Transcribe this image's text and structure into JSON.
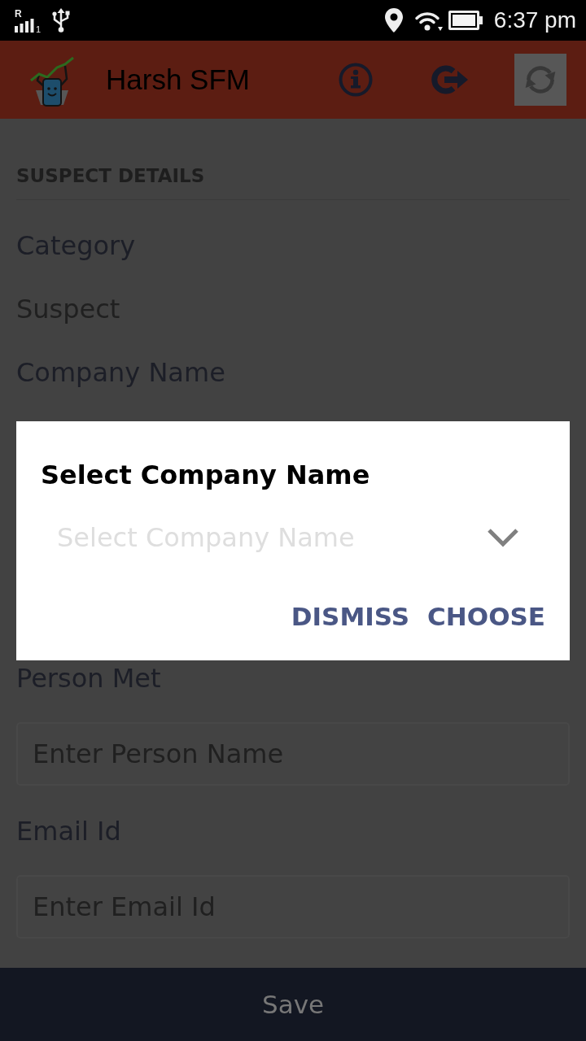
{
  "status_bar": {
    "roaming": "R",
    "sim": "1",
    "time": "6:37 pm"
  },
  "app_bar": {
    "title": "Harsh SFM"
  },
  "form": {
    "section_title": "SUSPECT DETAILS",
    "fields": [
      {
        "kind": "static",
        "label": "Category",
        "value": "Suspect"
      },
      {
        "kind": "picker",
        "label": "Company Name"
      },
      {
        "kind": "input",
        "label": "Person Met",
        "placeholder": "Enter Person Name"
      },
      {
        "kind": "input",
        "label": "Email Id",
        "placeholder": "Enter Email Id"
      }
    ]
  },
  "dialog": {
    "title": "Select Company Name",
    "dropdown": {
      "placeholder": "Select Company Name"
    },
    "buttons": [
      "DISMISS",
      "CHOOSE"
    ]
  },
  "save_button": {
    "label": "Save"
  }
}
